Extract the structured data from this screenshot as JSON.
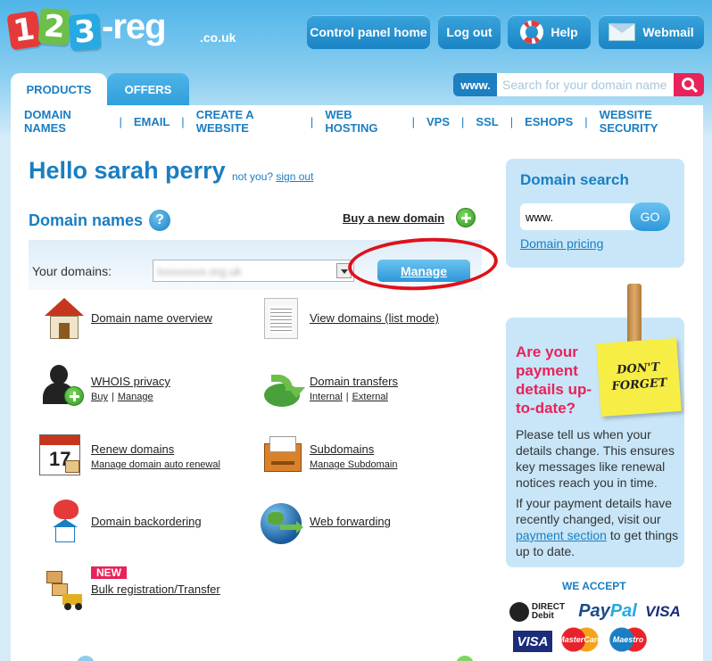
{
  "brand": {
    "logo_digits": [
      "1",
      "2",
      "3"
    ],
    "logo_name": "-reg",
    "logo_tld": ".co.uk"
  },
  "header_buttons": {
    "control_panel": "Control panel home",
    "logout": "Log out",
    "help": "Help",
    "webmail": "Webmail"
  },
  "tabs": {
    "products": "PRODUCTS",
    "offers": "OFFERS"
  },
  "top_search": {
    "prefix": "www.",
    "placeholder": "Search for your domain name"
  },
  "nav": [
    "DOMAIN NAMES",
    "EMAIL",
    "CREATE A WEBSITE",
    "WEB HOSTING",
    "VPS",
    "SSL",
    "ESHOPS",
    "WEBSITE SECURITY"
  ],
  "greeting": {
    "hello": "Hello sarah perry",
    "not_you": "not you?",
    "sign_out": "sign out"
  },
  "domain_names": {
    "title": "Domain names",
    "help_glyph": "?",
    "buy_link": "Buy a new domain",
    "your_domains_label": "Your domains:",
    "selected_domain_blurred": "lxxxxxxxx.org.uk",
    "manage_button": "Manage"
  },
  "links": {
    "overview": "Domain name overview",
    "view_list": "View domains (list mode)",
    "whois": "WHOIS privacy",
    "whois_buy": "Buy",
    "whois_manage": "Manage",
    "transfers": "Domain transfers",
    "transfers_internal": "Internal",
    "transfers_external": "External",
    "renew": "Renew domains",
    "renew_sub": "Manage domain auto renewal",
    "subdomains": "Subdomains",
    "subdomains_sub": "Manage Subdomain",
    "backorder": "Domain backordering",
    "forwarding": "Web forwarding",
    "new_badge": "NEW",
    "bulk": "Bulk registration/Transfer",
    "calendar_day": "17"
  },
  "domain_search": {
    "title": "Domain search",
    "value": "www.",
    "go": "GO",
    "pricing": "Domain pricing"
  },
  "payment": {
    "title": "Are your payment details up-to-date?",
    "sticky_line1": "DON'T",
    "sticky_line2": "FORGET",
    "text1": "Please tell us when your details change. This ensures key messages like renewal notices reach you in time.",
    "text2_pre": "If your payment details have recently changed, visit our",
    "text2_link": "payment section",
    "text2_post": "to get things up to date."
  },
  "accept": {
    "title": "WE ACCEPT",
    "direct_debit_1": "DIRECT",
    "direct_debit_2": "Debit",
    "paypal_pay": "Pay",
    "paypal_pal": "Pal",
    "visa": "VISA",
    "visa_electron": "VISA",
    "mastercard": "MasterCard",
    "maestro": "Maestro"
  }
}
